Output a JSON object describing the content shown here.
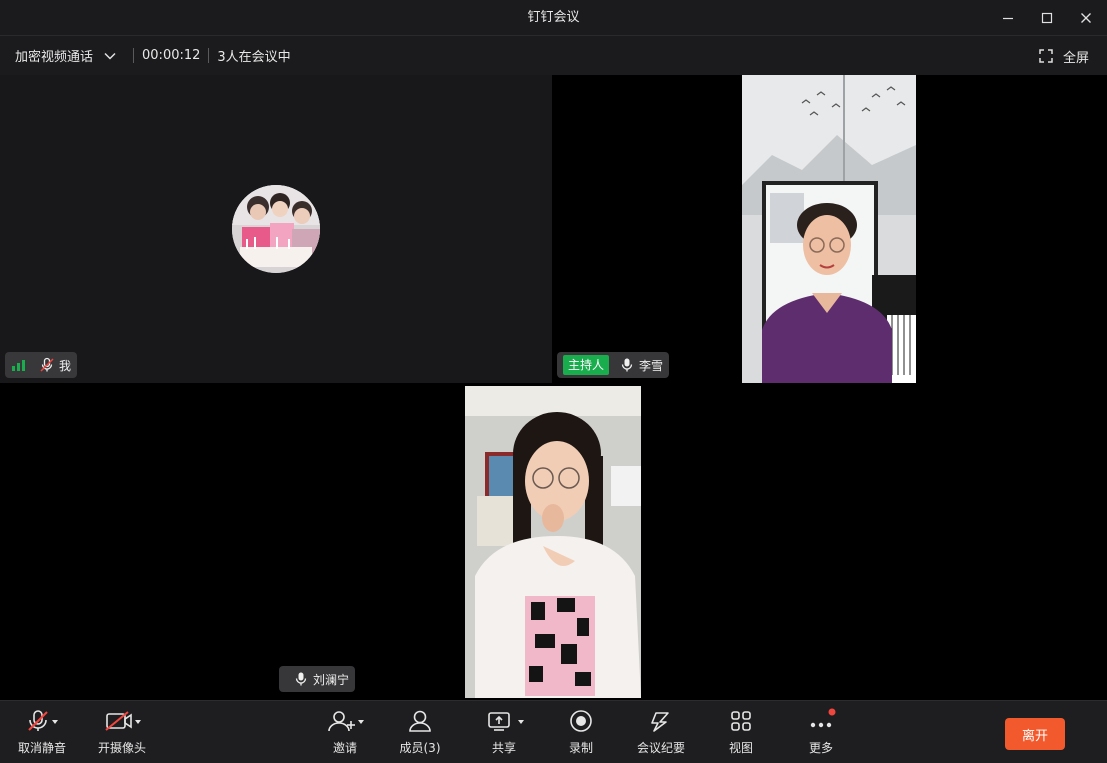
{
  "window": {
    "title": "钉钉会议"
  },
  "infobar": {
    "mode": "加密视频通话",
    "timer": "00:00:12",
    "participants_text": "3人在会议中",
    "fullscreen_label": "全屏"
  },
  "tiles": {
    "me": {
      "name": "我"
    },
    "host": {
      "badge": "主持人",
      "name": "李雪"
    },
    "third": {
      "name": "刘澜宁"
    }
  },
  "toolbar": {
    "unmute": "取消静音",
    "camera": "开摄像头",
    "invite": "邀请",
    "members": "成员(3)",
    "share": "共享",
    "record": "录制",
    "minutes": "会议纪要",
    "view": "视图",
    "more": "更多",
    "leave": "离开"
  },
  "colors": {
    "accent_leave": "#f25a2d",
    "host_badge": "#1aad4e",
    "signal": "#1aad4e",
    "notification_dot": "#f2453d"
  }
}
